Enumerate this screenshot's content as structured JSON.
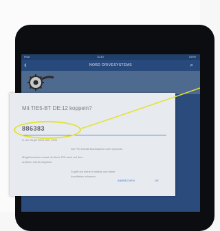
{
  "statusbar": {
    "carrier": "iPad",
    "time": "11:43",
    "battery": "100%"
  },
  "navbar": {
    "title": "NORD DRIVESYSTEMS"
  },
  "dialog": {
    "title": "Mit TIE5-BT DE:12 koppeln?",
    "pin_value": "886383",
    "hint_default": "In der Regel 0000 oder 1234",
    "hint_letters": "Die PIN enthält Buchstaben oder Symbole",
    "hint_other_1": "Möglicherweise musst du diese PIN auch auf dem",
    "hint_other_2": "anderen Gerät eingeben.",
    "checkbox_line_1": "Zugriff auf deine Kontakte und deine",
    "checkbox_line_2": "Anruflisten zulassen",
    "cancel_label": "ABBRECHEN",
    "ok_label": "OK"
  },
  "colors": {
    "screen": "#2a4b7c",
    "accent": "#4b7ec4",
    "highlight": "#e3e232"
  }
}
